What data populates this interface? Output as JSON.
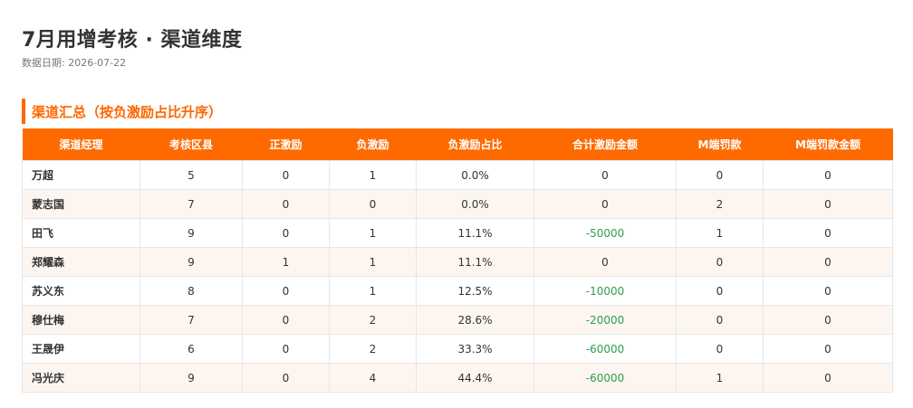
{
  "page": {
    "title": "7月用增考核 · 渠道维度",
    "date_label": "数据日期: 2026-07-22"
  },
  "section": {
    "title": "渠道汇总（按负激励占比升序）"
  },
  "colors": {
    "accent": "#ff6600",
    "header_bg": "#ff6a00",
    "row_alt": "#fdf6f0",
    "negative": "#2e9e4f"
  },
  "table": {
    "headers": [
      "渠道经理",
      "考核区县",
      "正激励",
      "负激励",
      "负激励占比",
      "合计激励金额",
      "M端罚款",
      "M端罚款金额"
    ],
    "rows": [
      {
        "name": "万超",
        "districts": "5",
        "pos": "0",
        "neg": "1",
        "neg_ratio": "0.0%",
        "total": "0",
        "m_fine": "0",
        "m_fine_amount": "0"
      },
      {
        "name": "蒙志国",
        "districts": "7",
        "pos": "0",
        "neg": "0",
        "neg_ratio": "0.0%",
        "total": "0",
        "m_fine": "2",
        "m_fine_amount": "0"
      },
      {
        "name": "田飞",
        "districts": "9",
        "pos": "0",
        "neg": "1",
        "neg_ratio": "11.1%",
        "total": "-50000",
        "m_fine": "1",
        "m_fine_amount": "0"
      },
      {
        "name": "郑耀森",
        "districts": "9",
        "pos": "1",
        "neg": "1",
        "neg_ratio": "11.1%",
        "total": "0",
        "m_fine": "0",
        "m_fine_amount": "0"
      },
      {
        "name": "苏义东",
        "districts": "8",
        "pos": "0",
        "neg": "1",
        "neg_ratio": "12.5%",
        "total": "-10000",
        "m_fine": "0",
        "m_fine_amount": "0"
      },
      {
        "name": "穆仕梅",
        "districts": "7",
        "pos": "0",
        "neg": "2",
        "neg_ratio": "28.6%",
        "total": "-20000",
        "m_fine": "0",
        "m_fine_amount": "0"
      },
      {
        "name": "王晟伊",
        "districts": "6",
        "pos": "0",
        "neg": "2",
        "neg_ratio": "33.3%",
        "total": "-60000",
        "m_fine": "0",
        "m_fine_amount": "0"
      },
      {
        "name": "冯光庆",
        "districts": "9",
        "pos": "0",
        "neg": "4",
        "neg_ratio": "44.4%",
        "total": "-60000",
        "m_fine": "1",
        "m_fine_amount": "0"
      }
    ]
  }
}
